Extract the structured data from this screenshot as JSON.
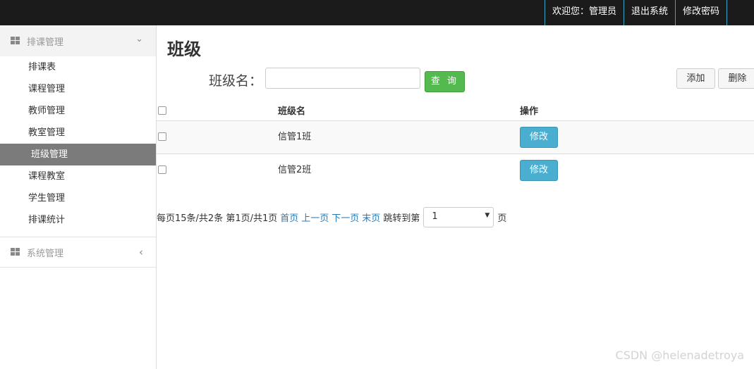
{
  "topbar": {
    "links": [
      "欢迎您：管理员",
      "退出系统",
      "修改密码"
    ]
  },
  "sidebar": {
    "group1": {
      "label": "排课管理",
      "chevron": "chevron-down-icon"
    },
    "items": [
      {
        "label": "排课表",
        "active": false
      },
      {
        "label": "课程管理",
        "active": false
      },
      {
        "label": "教师管理",
        "active": false
      },
      {
        "label": "教室管理",
        "active": false
      },
      {
        "label": "班级管理",
        "active": true
      },
      {
        "label": "课程教室",
        "active": false
      },
      {
        "label": "学生管理",
        "active": false
      },
      {
        "label": "排课统计",
        "active": false
      }
    ],
    "group2": {
      "label": "系统管理",
      "chevron": "chevron-left-icon"
    }
  },
  "main": {
    "title": "班级",
    "search": {
      "label": "班级名：",
      "value": "",
      "button": "查 询"
    },
    "actions": {
      "add": "添加",
      "delete": "删除"
    },
    "table": {
      "headers": {
        "name": "班级名",
        "op": "操作"
      },
      "rows": [
        {
          "name": "信管1班",
          "action": "修改"
        },
        {
          "name": "信管2班",
          "action": "修改"
        }
      ]
    },
    "pager": {
      "info": "每页15条/共2条 第1页/共1页",
      "first": "首页",
      "prev": "上一页",
      "next": "下一页",
      "last": "末页",
      "jump": "跳转到第",
      "selected": "1",
      "suffix": "页"
    }
  },
  "watermark": "CSDN @helenadetroya",
  "colors": {
    "topbar": "#1b1b1b",
    "accent_divider": "#3aa6c4",
    "active_menu": "#7b7b7b",
    "query_button": "#54b94f",
    "edit_button": "#4aaed0",
    "link": "#2a7ab8"
  }
}
